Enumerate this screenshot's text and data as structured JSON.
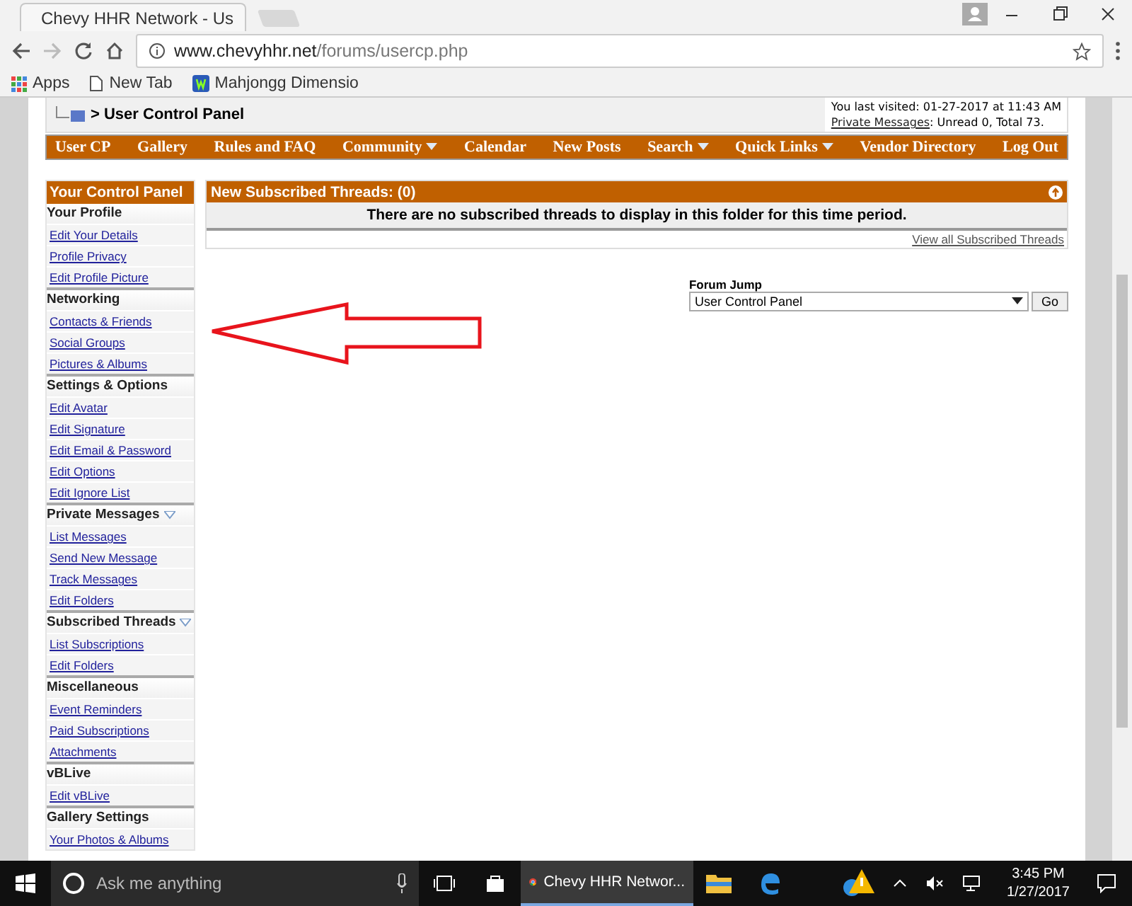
{
  "browser": {
    "tab_title": "Chevy HHR Network - Us",
    "url_host": "www.chevyhhr.net",
    "url_path": "/forums/usercp.php",
    "bookmarks": [
      {
        "label": "Apps",
        "kind": "apps"
      },
      {
        "label": "New Tab",
        "kind": "page"
      },
      {
        "label": "Mahjongg Dimensio",
        "kind": "site"
      }
    ]
  },
  "header": {
    "breadcrumb": "> User Control Panel",
    "last_visited": "You last visited: 01-27-2017 at 11:43 AM",
    "pm_link": "Private Messages",
    "pm_text": ": Unread 0, Total 73."
  },
  "nav": [
    {
      "label": "User CP",
      "menu": false
    },
    {
      "label": "Gallery",
      "menu": false
    },
    {
      "label": "Rules and FAQ",
      "menu": false
    },
    {
      "label": "Community",
      "menu": true
    },
    {
      "label": "Calendar",
      "menu": false
    },
    {
      "label": "New Posts",
      "menu": false
    },
    {
      "label": "Search",
      "menu": true
    },
    {
      "label": "Quick Links",
      "menu": true
    },
    {
      "label": "Vendor Directory",
      "menu": false
    },
    {
      "label": "Log Out",
      "menu": false
    }
  ],
  "sidebar": {
    "title": "Your Control Panel",
    "sections": [
      {
        "title": "Your Profile",
        "collapsible": false,
        "items": [
          "Edit Your Details",
          "Profile Privacy",
          "Edit Profile Picture"
        ]
      },
      {
        "title": "Networking",
        "collapsible": false,
        "items": [
          "Contacts & Friends",
          "Social Groups",
          "Pictures & Albums"
        ]
      },
      {
        "title": "Settings & Options",
        "collapsible": false,
        "items": [
          "Edit Avatar",
          "Edit Signature",
          "Edit Email & Password",
          "Edit Options",
          "Edit Ignore List"
        ]
      },
      {
        "title": "Private Messages",
        "collapsible": true,
        "items": [
          "List Messages",
          "Send New Message",
          "Track Messages",
          "Edit Folders"
        ]
      },
      {
        "title": "Subscribed Threads",
        "collapsible": true,
        "items": [
          "List Subscriptions",
          "Edit Folders"
        ]
      },
      {
        "title": "Miscellaneous",
        "collapsible": false,
        "items": [
          "Event Reminders",
          "Paid Subscriptions",
          "Attachments"
        ]
      },
      {
        "title": "vBLive",
        "collapsible": false,
        "items": [
          "Edit vBLive"
        ]
      },
      {
        "title": "Gallery Settings",
        "collapsible": false,
        "items": [
          "Your Photos & Albums"
        ]
      }
    ]
  },
  "threads": {
    "title": "New Subscribed Threads: (0)",
    "message": "There are no subscribed threads to display in this folder for this time period.",
    "view_all": "View all Subscribed Threads"
  },
  "forum_jump": {
    "label": "Forum Jump",
    "value": "User Control Panel",
    "button": "Go"
  },
  "taskbar": {
    "search_placeholder": "Ask me anything",
    "app": "Chevy HHR Networ...",
    "time": "3:45 PM",
    "date": "1/27/2017"
  }
}
